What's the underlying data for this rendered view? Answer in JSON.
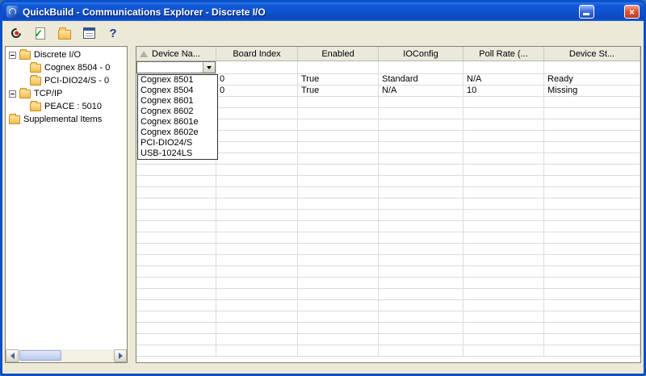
{
  "window": {
    "title": "QuickBuild - Communications Explorer - Discrete I/O",
    "close_glyph": "×"
  },
  "colors": {
    "titlebar_blue": "#0F52CE",
    "close_button_red": "#D6492A",
    "folder_yellow": "#F3BE4E"
  },
  "toolbar": {
    "icons": [
      {
        "name": "run-tool-icon"
      },
      {
        "name": "validate-icon",
        "glyph": "✓"
      },
      {
        "name": "open-folder-icon"
      },
      {
        "name": "report-view-icon"
      },
      {
        "name": "help-icon",
        "glyph": "?"
      }
    ]
  },
  "tree": {
    "items": [
      {
        "label": "Discrete I/O",
        "level": 0,
        "expanded": true
      },
      {
        "label": "Cognex 8504 - 0",
        "level": 1
      },
      {
        "label": "PCI-DIO24/S - 0",
        "level": 1
      },
      {
        "label": "TCP/IP",
        "level": 0,
        "expanded": true
      },
      {
        "label": "PEACE : 5010",
        "level": 1
      },
      {
        "label": "Supplemental Items",
        "level": 0
      }
    ]
  },
  "grid": {
    "columns": [
      "Device Na...",
      "Board Index",
      "Enabled",
      "IOConfig",
      "Poll Rate (...",
      "Device St..."
    ],
    "editor_value": "",
    "rows": [
      [
        "",
        "0",
        "True",
        "Standard",
        "N/A",
        "Ready"
      ],
      [
        "",
        "0",
        "True",
        "N/A",
        "10",
        "Missing"
      ]
    ]
  },
  "dropdown": {
    "options": [
      "Cognex 8501",
      "Cognex 8504",
      "Cognex 8601",
      "Cognex 8602",
      "Cognex 8601e",
      "Cognex 8602e",
      "PCI-DIO24/S",
      "USB-1024LS"
    ]
  }
}
